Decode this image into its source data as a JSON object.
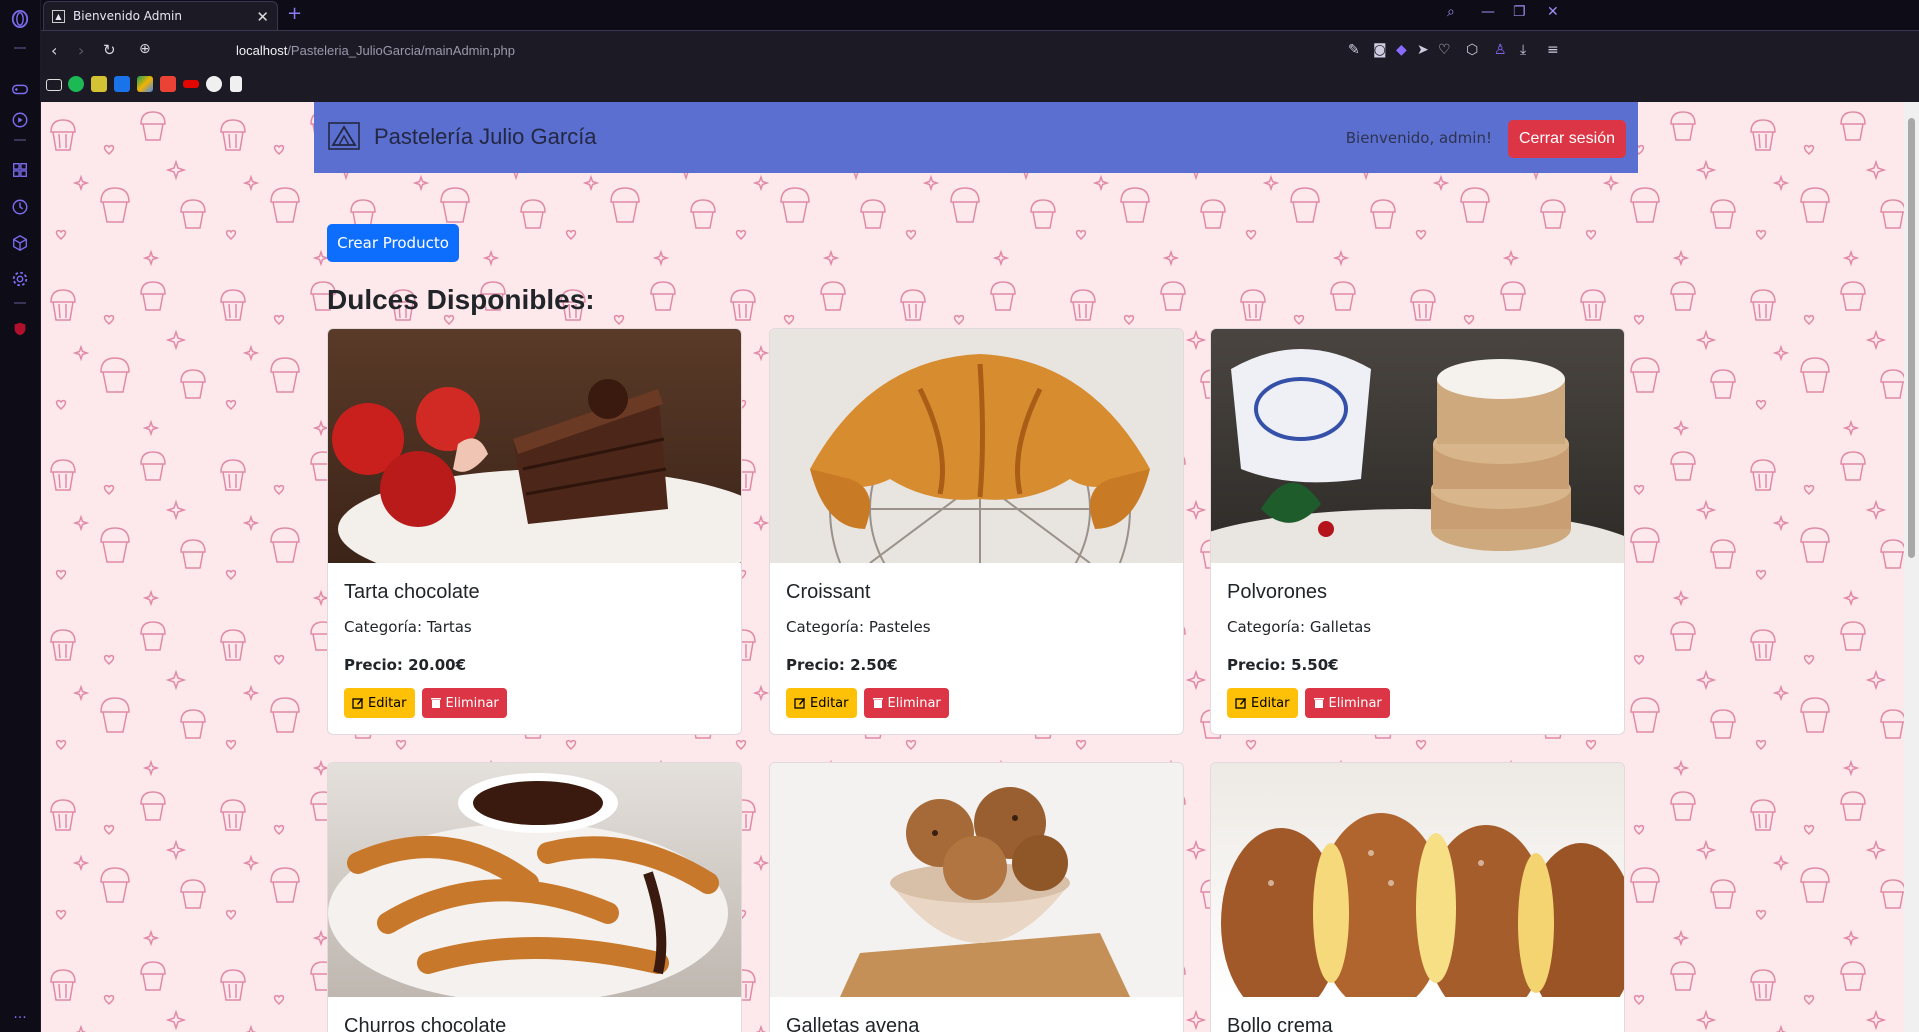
{
  "browser": {
    "tab_title": "Bienvenido Admin",
    "url_host": "localhost",
    "url_path": "/Pasteleria_JulioGarcia/mainAdmin.php"
  },
  "navbar": {
    "brand": "Pastelería Julio García",
    "welcome": "Bienvenido, admin!",
    "logout_label": "Cerrar sesión"
  },
  "page": {
    "create_label": "Crear Producto",
    "heading": "Dulces Disponibles:",
    "edit_label": "Editar",
    "delete_label": "Eliminar"
  },
  "products": [
    {
      "name": "Tarta chocolate",
      "category": "Categoría: Tartas",
      "price": "Precio: 20.00€"
    },
    {
      "name": "Croissant",
      "category": "Categoría: Pasteles",
      "price": "Precio: 2.50€"
    },
    {
      "name": "Polvorones",
      "category": "Categoría: Galletas",
      "price": "Precio: 5.50€"
    },
    {
      "name": "Churros chocolate"
    },
    {
      "name": "Galletas avena"
    },
    {
      "name": "Bollo crema"
    }
  ],
  "colors": {
    "navbar": "#5b6fd1",
    "background": "#fde9ec",
    "pattern": "#e08aa8",
    "primary": "#0d6efd",
    "danger": "#dc3545",
    "warning": "#ffc107"
  }
}
